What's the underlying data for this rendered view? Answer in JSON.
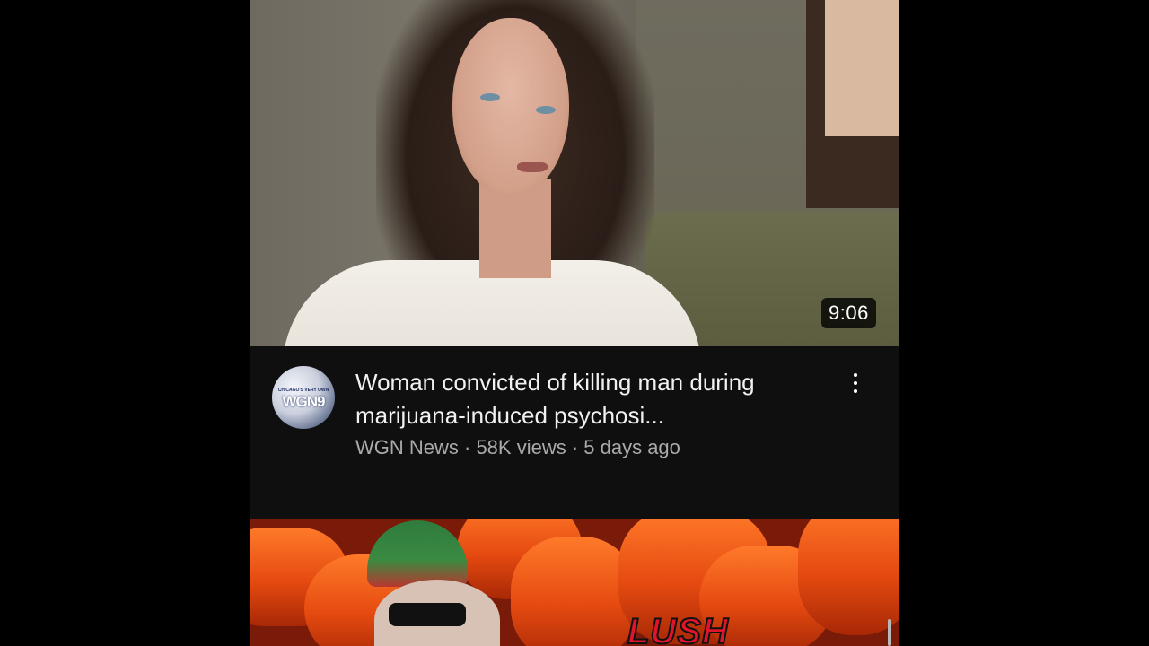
{
  "feed": {
    "videos": [
      {
        "duration": "9:06",
        "title": "Woman convicted of killing man during marijuana-induced psychosi...",
        "channel": "WGN News",
        "views": "58K views",
        "age": "5 days ago",
        "meta_line": "WGN News · 58K views · 5 days ago",
        "avatar_text": "WGN9",
        "avatar_small_text": "CHICAGO'S VERY OWN"
      },
      {
        "thumbnail_text": "LUSH"
      }
    ]
  },
  "icons": {
    "more_menu": "more-vertical-icon"
  },
  "colors": {
    "background": "#0f0f0f",
    "title_text": "#f1f1f1",
    "meta_text": "#aaaaaa",
    "duration_badge": "#000000"
  }
}
